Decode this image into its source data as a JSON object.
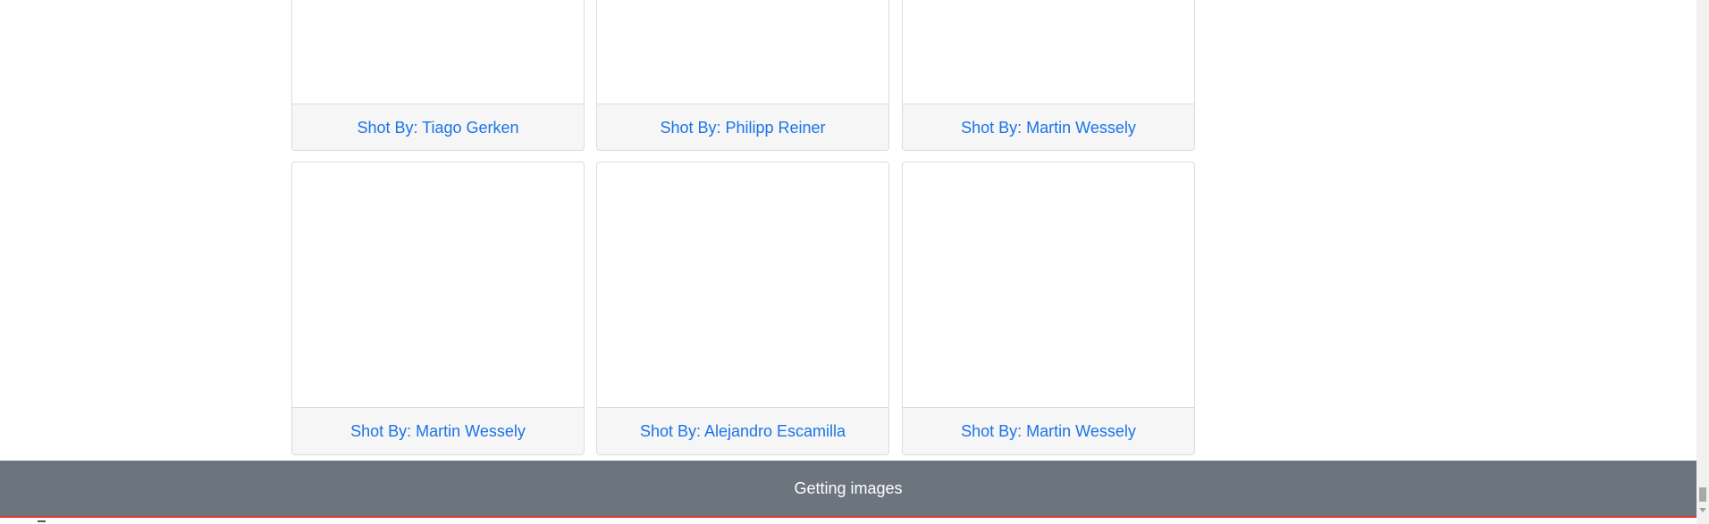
{
  "gallery": {
    "cards": [
      {
        "credit": "Shot By: Tiago Gerken"
      },
      {
        "credit": "Shot By: Philipp Reiner"
      },
      {
        "credit": "Shot By: Martin Wessely"
      },
      {
        "credit": "Shot By: Martin Wessely"
      },
      {
        "credit": "Shot By: Alejandro Escamilla"
      },
      {
        "credit": "Shot By: Martin Wessely"
      }
    ]
  },
  "status": {
    "message": "Getting images"
  },
  "colors": {
    "link": "#1a73e8",
    "status_bar": "#6c757d",
    "status_bar_border": "#d9342b"
  }
}
